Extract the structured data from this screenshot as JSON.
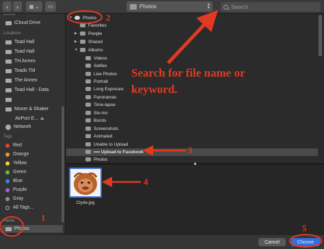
{
  "toolbar": {
    "back_glyph": "‹",
    "forward_glyph": "›",
    "view_glyph": "▦ ⌄",
    "newfolder_glyph": "▭",
    "location_label": "Photos",
    "search_placeholder": "Search"
  },
  "sidebar": {
    "icloud_heading": "iCloud",
    "icloud_drive": "iCloud Drive",
    "locations_heading": "Locations",
    "locations": [
      "Toad Hall",
      "Toad Hall",
      "TH Annex",
      "Toads TM",
      "The Annex",
      "Toad Hall - Data",
      "",
      "Mover & Shaker",
      "AirPort E...",
      "Network"
    ],
    "tags_heading": "Tags",
    "tags": [
      {
        "label": "Red",
        "color": "#e0443a"
      },
      {
        "label": "Orange",
        "color": "#f0962c"
      },
      {
        "label": "Yellow",
        "color": "#f3d23b"
      },
      {
        "label": "Green",
        "color": "#5bc04a"
      },
      {
        "label": "Blue",
        "color": "#3f82e8"
      },
      {
        "label": "Purple",
        "color": "#a45ed0"
      },
      {
        "label": "Gray",
        "color": "#8e8e8e"
      },
      {
        "label": "All Tags...",
        "color": "#bbbbbb"
      }
    ],
    "media_heading": "Media",
    "media_item": "Photos"
  },
  "tree": [
    {
      "label": "Photos",
      "indent": 0,
      "arrow": "▼",
      "sel": false
    },
    {
      "label": "Favorites",
      "indent": 1,
      "arrow": "",
      "sel": false
    },
    {
      "label": "People",
      "indent": 1,
      "arrow": "▶",
      "sel": false
    },
    {
      "label": "Shared",
      "indent": 1,
      "arrow": "▶",
      "sel": false
    },
    {
      "label": "Albums",
      "indent": 1,
      "arrow": "▼",
      "sel": false
    },
    {
      "label": "Videos",
      "indent": 2,
      "arrow": "",
      "sel": false
    },
    {
      "label": "Selfies",
      "indent": 2,
      "arrow": "",
      "sel": false
    },
    {
      "label": "Live Photos",
      "indent": 2,
      "arrow": "",
      "sel": false
    },
    {
      "label": "Portrait",
      "indent": 2,
      "arrow": "",
      "sel": false
    },
    {
      "label": "Long Exposure",
      "indent": 2,
      "arrow": "",
      "sel": false
    },
    {
      "label": "Panoramas",
      "indent": 2,
      "arrow": "",
      "sel": false
    },
    {
      "label": "Time-lapse",
      "indent": 2,
      "arrow": "",
      "sel": false
    },
    {
      "label": "Slo-mo",
      "indent": 2,
      "arrow": "",
      "sel": false
    },
    {
      "label": "Bursts",
      "indent": 2,
      "arrow": "",
      "sel": false
    },
    {
      "label": "Screenshots",
      "indent": 2,
      "arrow": "",
      "sel": false
    },
    {
      "label": "Animated",
      "indent": 2,
      "arrow": "",
      "sel": false
    },
    {
      "label": "Unable to Upload",
      "indent": 2,
      "arrow": "",
      "sel": false
    },
    {
      "label": "•••• Upload to Facebook",
      "indent": 2,
      "arrow": "",
      "sel": true
    },
    {
      "label": "Photos",
      "indent": 2,
      "arrow": "",
      "sel": false
    }
  ],
  "preview": {
    "filename": "Clyde.jpg"
  },
  "footer": {
    "cancel_label": "Cancel",
    "choose_label": "Choose"
  },
  "annotations": {
    "search_hint_line1": "Search for file name or",
    "search_hint_line2": "keyword.",
    "n1": "1",
    "n2": "2",
    "n3": "3",
    "n4": "4",
    "n5": "5"
  },
  "colors": {
    "annotation_red": "#e23a22",
    "accent_blue": "#3d6fd8"
  }
}
